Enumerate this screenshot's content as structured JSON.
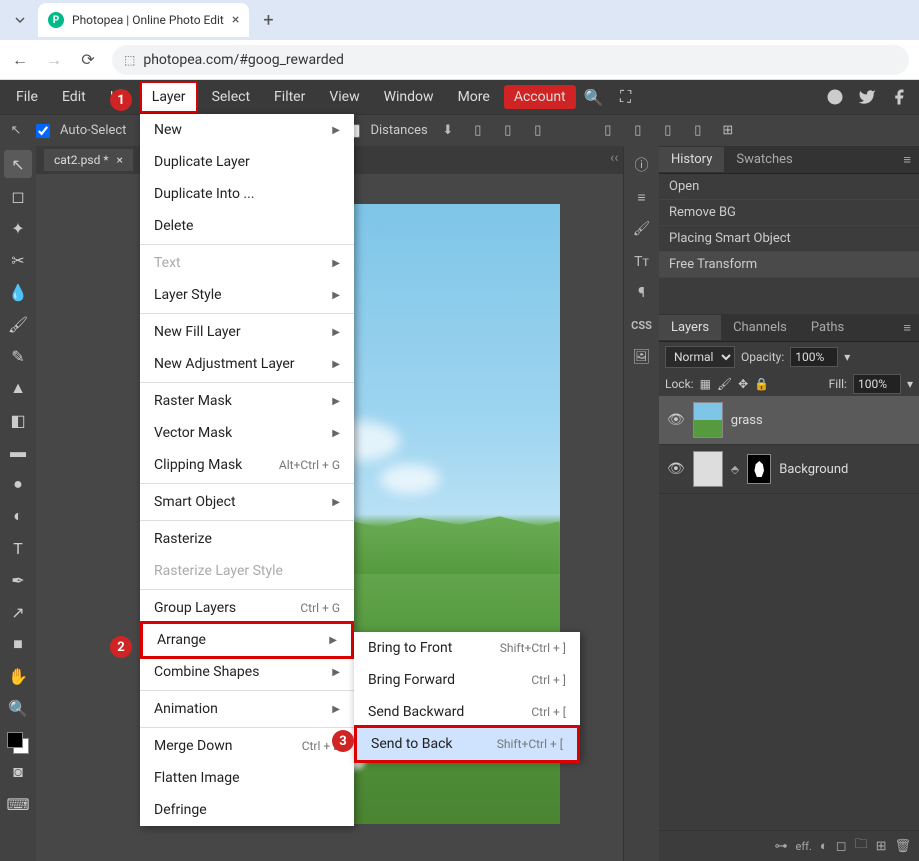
{
  "browser": {
    "tab_title": "Photopea | Online Photo Edit",
    "url": "photopea.com/#goog_rewarded"
  },
  "menubar": {
    "items": [
      "File",
      "Edit",
      "Im",
      "Layer",
      "Select",
      "Filter",
      "View",
      "Window",
      "More",
      "Account"
    ],
    "active": "Layer"
  },
  "toolbar": {
    "auto_select": "Auto-Select",
    "distances": "Distances"
  },
  "doc_tab": "cat2.psd *",
  "layer_menu": [
    {
      "label": "New",
      "sub": true
    },
    {
      "label": "Duplicate Layer"
    },
    {
      "label": "Duplicate Into ..."
    },
    {
      "label": "Delete"
    },
    {
      "sep": true
    },
    {
      "label": "Text",
      "sub": true,
      "disabled": true
    },
    {
      "label": "Layer Style",
      "sub": true
    },
    {
      "sep": true
    },
    {
      "label": "New Fill Layer",
      "sub": true
    },
    {
      "label": "New Adjustment Layer",
      "sub": true
    },
    {
      "sep": true
    },
    {
      "label": "Raster Mask",
      "sub": true
    },
    {
      "label": "Vector Mask",
      "sub": true
    },
    {
      "label": "Clipping Mask",
      "shortcut": "Alt+Ctrl + G"
    },
    {
      "sep": true
    },
    {
      "label": "Smart Object",
      "sub": true
    },
    {
      "sep": true
    },
    {
      "label": "Rasterize"
    },
    {
      "label": "Rasterize Layer Style",
      "disabled": true
    },
    {
      "sep": true
    },
    {
      "label": "Group Layers",
      "shortcut": "Ctrl + G"
    },
    {
      "label": "Arrange",
      "sub": true,
      "highlight": true
    },
    {
      "label": "Combine Shapes",
      "sub": true
    },
    {
      "sep": true
    },
    {
      "label": "Animation",
      "sub": true
    },
    {
      "sep": true
    },
    {
      "label": "Merge Down",
      "shortcut": "Ctrl + E"
    },
    {
      "label": "Flatten Image"
    },
    {
      "label": "Defringe"
    }
  ],
  "arrange_sub": [
    {
      "label": "Bring to Front",
      "shortcut": "Shift+Ctrl + ]"
    },
    {
      "label": "Bring Forward",
      "shortcut": "Ctrl + ]"
    },
    {
      "label": "Send Backward",
      "shortcut": "Ctrl + ["
    },
    {
      "label": "Send to Back",
      "shortcut": "Shift+Ctrl + [",
      "highlight": true
    }
  ],
  "history": {
    "title": "History",
    "swatches": "Swatches",
    "items": [
      "Open",
      "Remove BG",
      "Placing Smart Object",
      "Free Transform"
    ]
  },
  "layers_panel": {
    "tabs": [
      "Layers",
      "Channels",
      "Paths"
    ],
    "blend": "Normal",
    "opacity_label": "Opacity:",
    "opacity": "100%",
    "lock_label": "Lock:",
    "fill_label": "Fill:",
    "fill": "100%",
    "layers": [
      {
        "name": "grass",
        "selected": true
      },
      {
        "name": "Background"
      }
    ]
  },
  "side_labels": {
    "css": "CSS"
  },
  "callouts": {
    "1": "1",
    "2": "2",
    "3": "3"
  }
}
